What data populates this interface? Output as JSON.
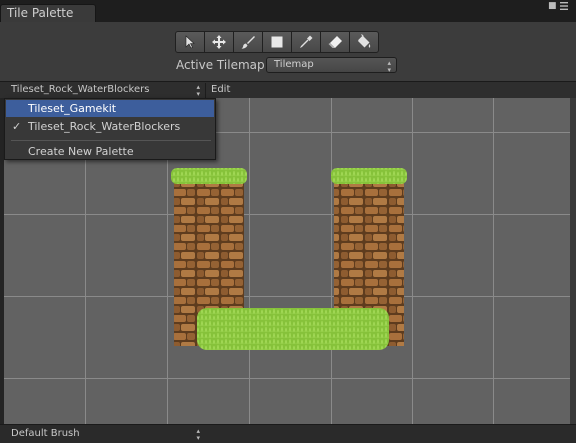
{
  "window": {
    "tab_title": "Tile Palette",
    "menu_icon": "kebab-menu-icon",
    "pin_icon": "pin-icon"
  },
  "toolbar": {
    "tools": [
      {
        "name": "select-tool",
        "icon": "arrow-cursor-icon"
      },
      {
        "name": "move-tool",
        "icon": "move-arrows-icon"
      },
      {
        "name": "paint-tool",
        "icon": "brush-icon"
      },
      {
        "name": "box-fill-tool",
        "icon": "rectangle-icon"
      },
      {
        "name": "pick-tool",
        "icon": "eyedropper-icon"
      },
      {
        "name": "erase-tool",
        "icon": "eraser-icon"
      },
      {
        "name": "fill-tool",
        "icon": "paint-bucket-icon"
      }
    ],
    "active_tilemap_label": "Active Tilemap",
    "active_tilemap_value": "Tilemap"
  },
  "palette": {
    "selected": "Tileset_Rock_WaterBlockers",
    "edit_label": "Edit",
    "dropdown_items": [
      {
        "label": "Tileset_Gamekit",
        "highlighted": true,
        "checked": false
      },
      {
        "label": "Tileset_Rock_WaterBlockers",
        "highlighted": false,
        "checked": true
      }
    ],
    "create_new_label": "Create New Palette",
    "check_mark": "✓"
  },
  "bottom": {
    "brush": "Default Brush"
  },
  "colors": {
    "highlight": "#3d5e9c",
    "grid_bg": "#626262",
    "grass": "#8cc63f",
    "rock": "#8a5a30"
  }
}
